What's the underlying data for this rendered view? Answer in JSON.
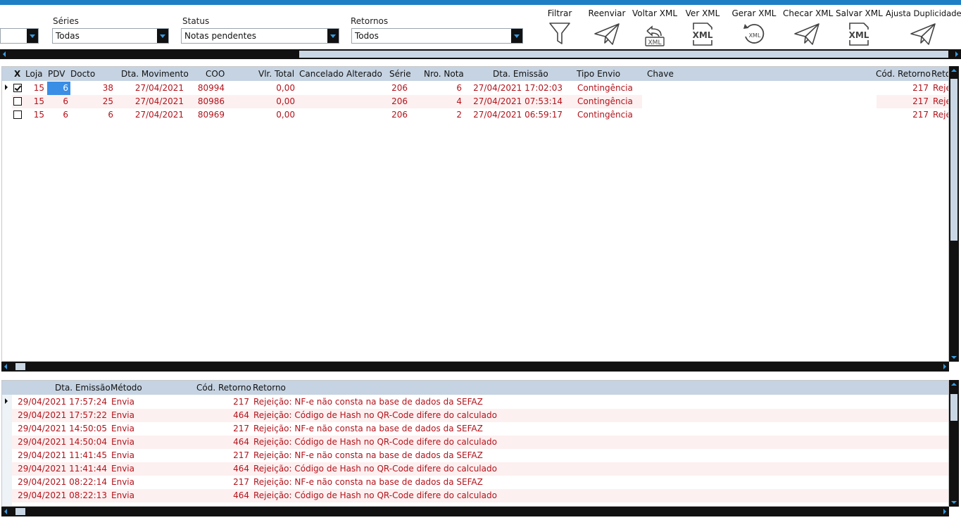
{
  "filters": {
    "first": {
      "label": "",
      "value": ""
    },
    "series": {
      "label": "Séries",
      "value": "Todas"
    },
    "status": {
      "label": "Status",
      "value": "Notas pendentes"
    },
    "retornos": {
      "label": "Retornos",
      "value": "Todos"
    }
  },
  "toolbar": [
    {
      "label": "Filtrar",
      "icon": "funnel-icon"
    },
    {
      "label": "Reenviar",
      "icon": "paper-plane-icon"
    },
    {
      "label": "Voltar XML",
      "icon": "xml-undo-icon"
    },
    {
      "label": "Ver XML",
      "icon": "xml-file-icon"
    },
    {
      "label": "Gerar XML",
      "icon": "xml-refresh-icon"
    },
    {
      "label": "Checar XML",
      "icon": "paper-plane-icon"
    },
    {
      "label": "Salvar XML",
      "icon": "xml-file-icon"
    },
    {
      "label": "Ajusta Duplicidade",
      "icon": "paper-plane-icon"
    }
  ],
  "xml_icon_text": "XML",
  "notes_grid": {
    "headers": {
      "x": "X",
      "loja": "Loja",
      "pdv": "PDV",
      "docto": "Docto",
      "dta_mov": "Dta. Movimento",
      "coo": "COO",
      "vlr_total": "Vlr. Total",
      "cancelado": "Cancelado",
      "alterado": "Alterado",
      "serie": "Série",
      "nro_nota": "Nro. Nota",
      "dta_emissao": "Dta. Emissão",
      "tipo_envio": "Tipo Envio",
      "chave": "Chave",
      "cod_retorno": "Cód. Retorno",
      "retorno": "Reto"
    },
    "rows": [
      {
        "checked": true,
        "loja": "15",
        "pdv": "6",
        "docto": "38",
        "dta_mov": "27/04/2021",
        "coo": "80994",
        "vlr_total": "0,00",
        "serie": "206",
        "nro_nota": "6",
        "dta_emissao": "27/04/2021 17:02:03",
        "tipo_envio": "Contingência",
        "cod_retorno": "217",
        "retorno": "Reje"
      },
      {
        "checked": false,
        "loja": "15",
        "pdv": "6",
        "docto": "25",
        "dta_mov": "27/04/2021",
        "coo": "80986",
        "vlr_total": "0,00",
        "serie": "206",
        "nro_nota": "4",
        "dta_emissao": "27/04/2021 07:53:14",
        "tipo_envio": "Contingência",
        "cod_retorno": "217",
        "retorno": "Reje"
      },
      {
        "checked": false,
        "loja": "15",
        "pdv": "6",
        "docto": "6",
        "dta_mov": "27/04/2021",
        "coo": "80969",
        "vlr_total": "0,00",
        "serie": "206",
        "nro_nota": "2",
        "dta_emissao": "27/04/2021 06:59:17",
        "tipo_envio": "Contingência",
        "cod_retorno": "217",
        "retorno": "Reje"
      }
    ]
  },
  "history_grid": {
    "headers": {
      "dta_emissao": "Dta. Emissão",
      "metodo": "Método",
      "cod_retorno": "Cód. Retorno",
      "retorno": "Retorno"
    },
    "rows": [
      {
        "dta_emissao": "29/04/2021 17:57:24",
        "metodo": "Envia",
        "cod_retorno": "217",
        "retorno": "Rejeição: NF-e não consta na base de dados da SEFAZ"
      },
      {
        "dta_emissao": "29/04/2021 17:57:22",
        "metodo": "Envia",
        "cod_retorno": "464",
        "retorno": "Rejeição: Código de Hash no QR-Code difere do calculado"
      },
      {
        "dta_emissao": "29/04/2021 14:50:05",
        "metodo": "Envia",
        "cod_retorno": "217",
        "retorno": "Rejeição: NF-e não consta na base de dados da SEFAZ"
      },
      {
        "dta_emissao": "29/04/2021 14:50:04",
        "metodo": "Envia",
        "cod_retorno": "464",
        "retorno": "Rejeição: Código de Hash no QR-Code difere do calculado"
      },
      {
        "dta_emissao": "29/04/2021 11:41:45",
        "metodo": "Envia",
        "cod_retorno": "217",
        "retorno": "Rejeição: NF-e não consta na base de dados da SEFAZ"
      },
      {
        "dta_emissao": "29/04/2021 11:41:44",
        "metodo": "Envia",
        "cod_retorno": "464",
        "retorno": "Rejeição: Código de Hash no QR-Code difere do calculado"
      },
      {
        "dta_emissao": "29/04/2021 08:22:14",
        "metodo": "Envia",
        "cod_retorno": "217",
        "retorno": "Rejeição: NF-e não consta na base de dados da SEFAZ"
      },
      {
        "dta_emissao": "29/04/2021 08:22:13",
        "metodo": "Envia",
        "cod_retorno": "464",
        "retorno": "Rejeição: Código de Hash no QR-Code difere do calculado"
      }
    ]
  },
  "colors": {
    "accent": "#1f7fc4",
    "text_red": "#b3131b",
    "header_bg": "#c5d3e2",
    "alt_row": "#fdf0f0",
    "selection": "#3a8ee6"
  }
}
